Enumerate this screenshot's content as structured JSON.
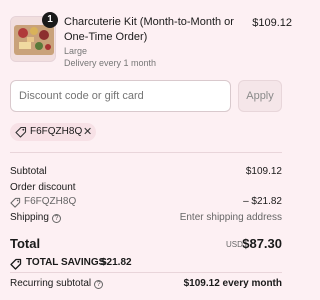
{
  "cart_item": {
    "quantity": "1",
    "title": "Charcuterie Kit (Month-to-Month or One-Time Order)",
    "size": "Large",
    "delivery": "Delivery every 1 month",
    "price": "$109.12"
  },
  "discount": {
    "placeholder": "Discount code or gift card",
    "apply_label": "Apply",
    "applied_code": "F6FQZH8Q",
    "remove_icon": "close-icon"
  },
  "summary": {
    "subtotal_label": "Subtotal",
    "subtotal_value": "$109.12",
    "order_discount_label": "Order discount",
    "discount_code": "F6FQZH8Q",
    "discount_value": "– $21.82",
    "shipping_label": "Shipping",
    "shipping_value": "Enter shipping address",
    "total_label": "Total",
    "currency": "USD",
    "total_value": "$87.30",
    "savings_label": "TOTAL SAVINGS",
    "savings_value": "$21.82",
    "recurring_label": "Recurring subtotal",
    "recurring_value": "$109.12 every month"
  },
  "colors": {
    "background": "#fdf0f3",
    "pill": "#f7e1e6",
    "text": "#1a1a1a"
  }
}
